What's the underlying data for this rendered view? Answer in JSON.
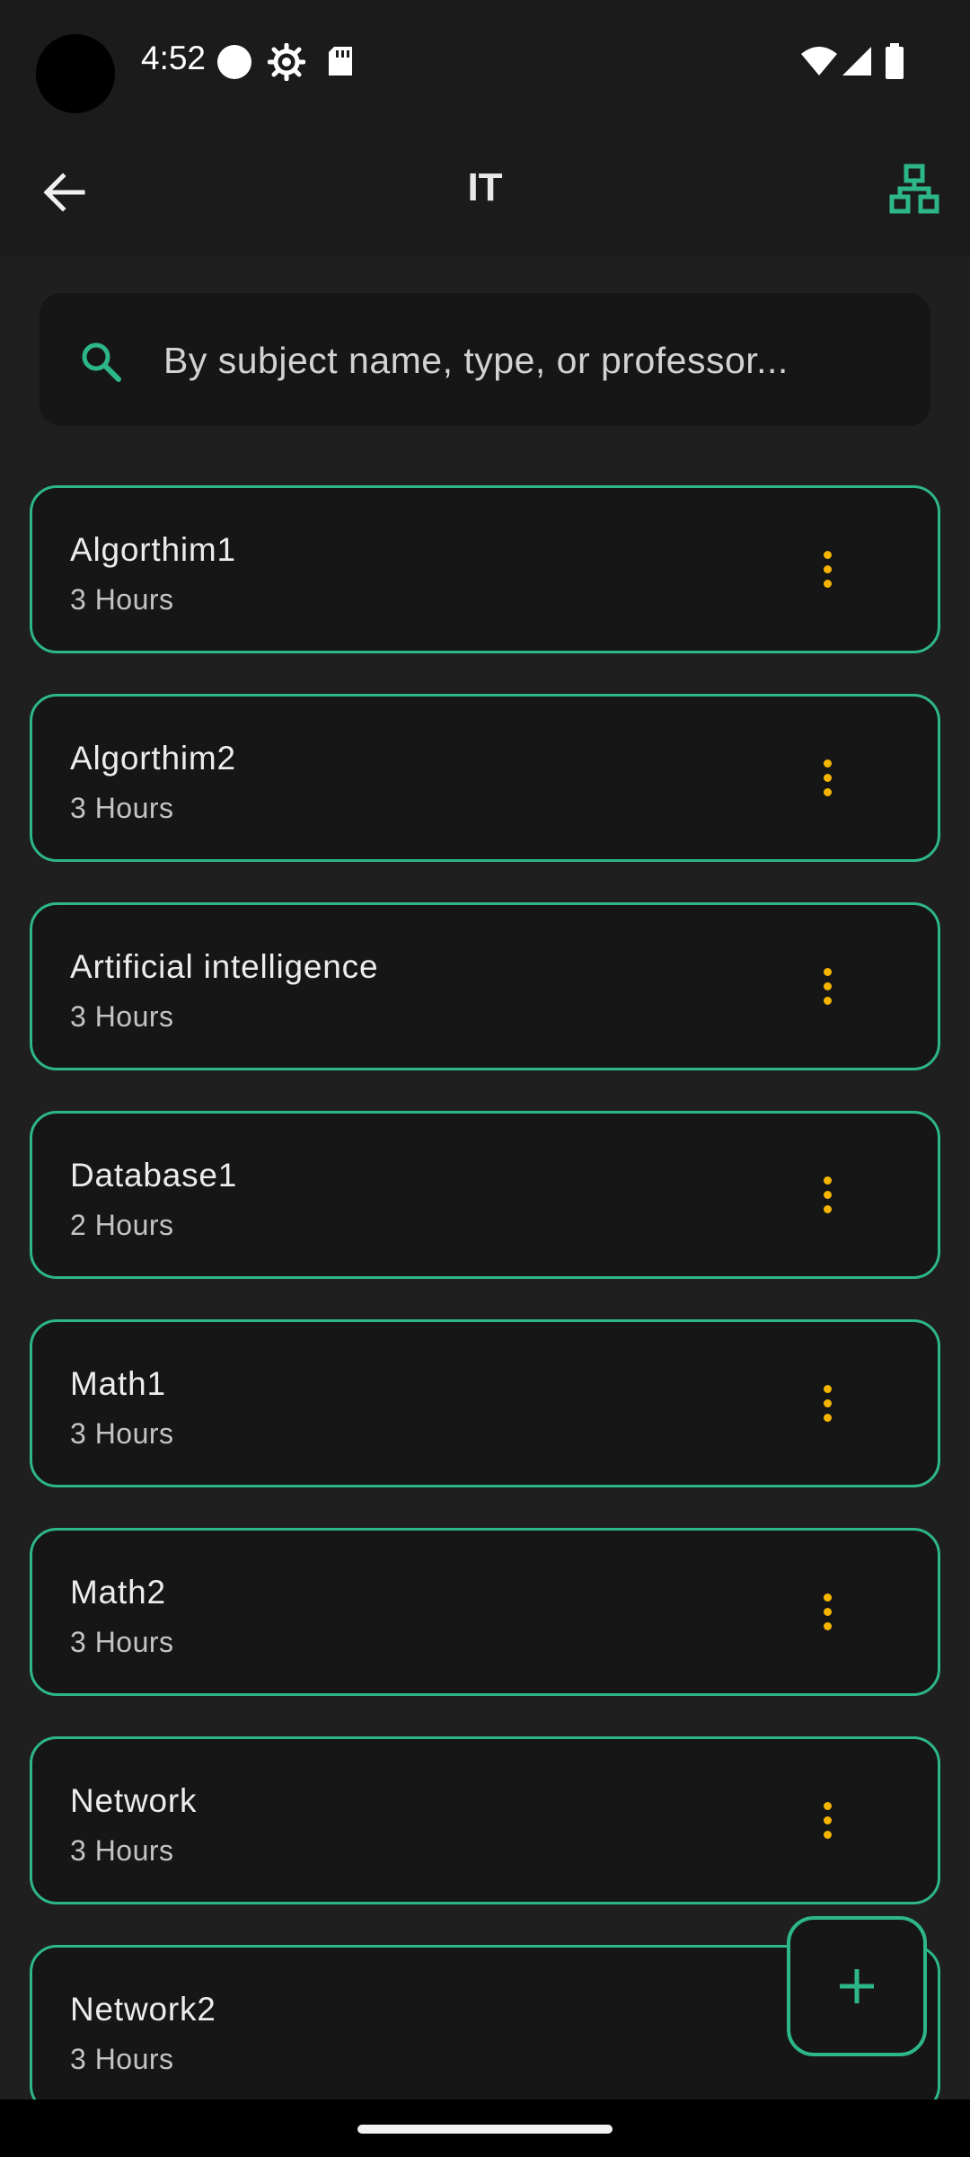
{
  "status_bar": {
    "time": "4:52",
    "left_icons": [
      "circle-icon",
      "settings-icon",
      "sd-card-icon"
    ],
    "right_icons": [
      "wifi-icon",
      "cell-signal-icon",
      "battery-icon"
    ]
  },
  "app_bar": {
    "title": "IT",
    "back_icon": "arrow-back-icon",
    "action_icon": "hierarchy-tree-icon"
  },
  "search": {
    "placeholder": "By subject name, type, or professor...",
    "value": ""
  },
  "subjects": [
    {
      "name": "Algorthim1",
      "hours": "3 Hours"
    },
    {
      "name": "Algorthim2",
      "hours": "3 Hours"
    },
    {
      "name": "Artificial intelligence",
      "hours": "3 Hours"
    },
    {
      "name": "Database1",
      "hours": "2 Hours"
    },
    {
      "name": "Math1",
      "hours": "3 Hours"
    },
    {
      "name": "Math2",
      "hours": "3 Hours"
    },
    {
      "name": "Network",
      "hours": "3 Hours"
    },
    {
      "name": "Network2",
      "hours": "3 Hours"
    }
  ],
  "fab": {
    "icon": "plus-icon"
  },
  "colors": {
    "accent": "#2db788",
    "menu_dots": "#f4b400",
    "background": "#1f1f1f",
    "card": "#161616"
  }
}
